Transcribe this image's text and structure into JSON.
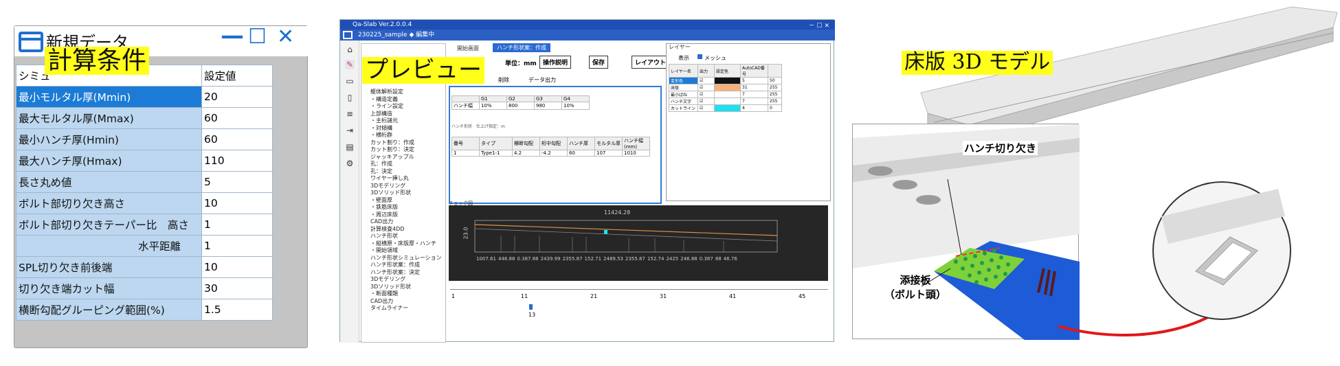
{
  "panel1": {
    "window_title": "新規データ",
    "overlay_label": "計算条件",
    "col_header_left": "シミュ",
    "col_header_right": "設定値",
    "rows": [
      {
        "label": "最小モルタル厚(Mmin)",
        "value": "20"
      },
      {
        "label": "最大モルタル厚(Mmax)",
        "value": "60"
      },
      {
        "label": "最小ハンチ厚(Hmin)",
        "value": "60"
      },
      {
        "label": "最大ハンチ厚(Hmax)",
        "value": "110"
      },
      {
        "label": "長さ丸め値",
        "value": "5"
      },
      {
        "label": "ボルト部切り欠き高さ",
        "value": "10"
      },
      {
        "label": "ボルト部切り欠きテーパー比　高さ",
        "value": "1"
      },
      {
        "label": "水平距離",
        "value": "1"
      },
      {
        "label": "SPL切り欠き前後端",
        "value": "10"
      },
      {
        "label": "切り欠き端カット幅",
        "value": "30"
      },
      {
        "label": "横断勾配グルーピング範囲(%)",
        "value": "1.5"
      }
    ],
    "window_buttons": {
      "minimize": "—",
      "maximize": "☐",
      "close": "✕"
    }
  },
  "panel2": {
    "overlay_label": "プレビュー",
    "app_title": "Qa-Slab Ver.2.0.0.4",
    "file_title": "230225_sample ◆ 編集中",
    "window_ctrl": "－ ☐ ✕",
    "tabs": [
      "開始画面",
      "ハンチ形状案：作成"
    ],
    "unit_label": "単位：mm",
    "toolbar": [
      "操作説明",
      "保存",
      "レイアウト保存"
    ],
    "edit_row": [
      "編集",
      "削除",
      "データ出力"
    ],
    "layer_panel_title": "レイヤー",
    "layer_display": "表示",
    "layer_mesh": "メッシュ",
    "layer_headers": [
      "レイヤー名",
      "出力",
      "設定色",
      "AutoCAD番号",
      ""
    ],
    "layers": [
      {
        "name": "変形色",
        "num": "5",
        "n2": "50",
        "color": "#111111"
      },
      {
        "name": "床版",
        "num": "31",
        "n2": "255",
        "color": "#f6b07a"
      },
      {
        "name": "最小ばね",
        "num": "7",
        "n2": "255",
        "color": "#ffffff"
      },
      {
        "name": "ハンチ文字",
        "num": "7",
        "n2": "255",
        "color": "#ffffff"
      },
      {
        "name": "カットライン",
        "num": "4",
        "n2": "0",
        "color": "#20e0f0"
      }
    ],
    "tree": [
      "躯体解析設定",
      "・構造定義",
      "・ライン設定",
      "上部構造",
      "・主桁諸元",
      "・対傾構",
      "・横桁群",
      "カット割り：作成",
      "カット割り：決定",
      "ジャッキアップル",
      "孔：作成",
      "孔：決定",
      "ワイヤー挿し丸",
      "3Dモデリング",
      "3Dソリッド形状",
      "・壁面厚",
      "・鉄筋床版",
      "・周辺床版",
      "CAD出力",
      "計算検査4DD",
      "ハンチ形状",
      "・縦横原・床版厚・ハンチ",
      "・開始領域",
      "ハンチ形状シミュレーション",
      "ハンチ形状案：作成",
      "ハンチ形状案：決定",
      "3Dモデリング",
      "3Dソリッド形状",
      "・断面種類",
      "CAD出力",
      "タイムライナー"
    ],
    "check_title": "チェック図",
    "grid1_headers": [
      "",
      "G1",
      "G2",
      "G3",
      "G4"
    ],
    "grid1_row": [
      "ハンチ幅",
      "10%",
      "800",
      "980",
      "10%"
    ],
    "grid2_title": "ハンチ形状　仕上げ指定：m",
    "grid2_headers": [
      "番号",
      "タイプ",
      "横断勾配",
      "桁中勾配",
      "ハンチ厚",
      "モルタル厚",
      "ハンチ幅(mm)"
    ],
    "grid2_row": [
      "1",
      "Type1-1",
      "4.2",
      "-4.2",
      "60",
      "107",
      "1010"
    ],
    "chart_top_value": "11424.28",
    "chart_left_value": "23.0",
    "chart_bottom_values": [
      "1007.61",
      "446.88",
      "0.387.88",
      "2439.99",
      "2355.87",
      "152.71",
      "2489.53",
      "2355.87",
      "152.74",
      "2425",
      "246.88",
      "0.387",
      "88",
      "46.76"
    ],
    "slider_ticks": [
      "1",
      "11",
      "21",
      "31",
      "41",
      "45"
    ],
    "slider_value": "13"
  },
  "panel3": {
    "overlay_label": "床版 3D モデル",
    "callout_haunch": "ハンチ切り欠き",
    "callout_plate_line1": "添接板",
    "callout_plate_line2": "（ボルト頭）"
  }
}
